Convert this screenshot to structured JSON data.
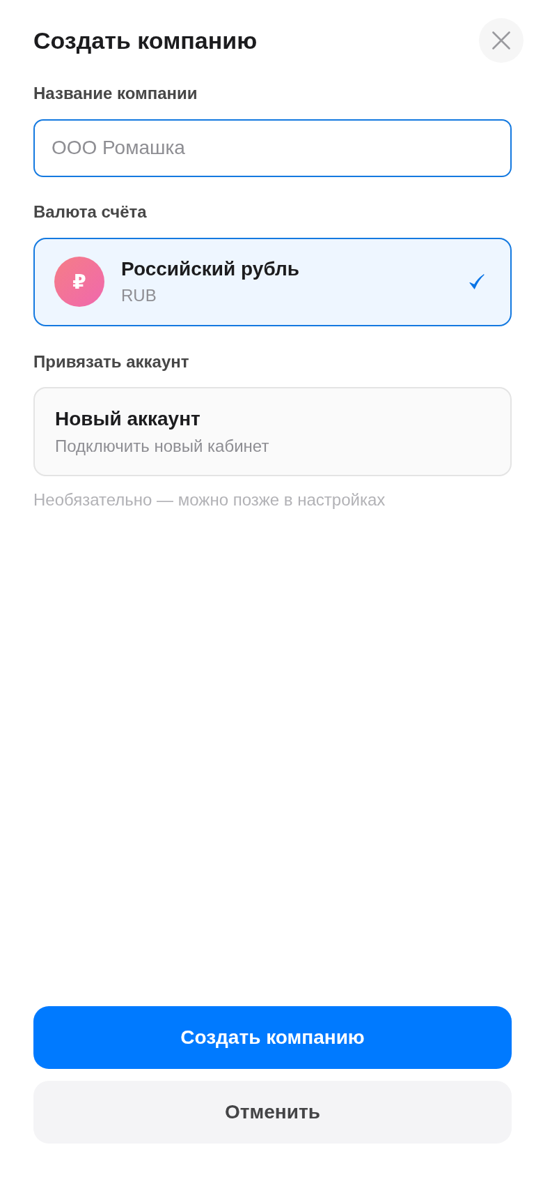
{
  "dialog": {
    "title": "Создать компанию"
  },
  "company_name": {
    "label": "Название компании",
    "placeholder": "ООО Ромашка",
    "focused": true
  },
  "currency": {
    "label": "Валюта счёта",
    "options": [
      {
        "symbol": "₽",
        "name": "Российский рубль",
        "code": "RUB",
        "selected": true
      }
    ]
  },
  "account": {
    "label": "Привязать аккаунт",
    "options": [
      {
        "title": "Новый аккаунт",
        "subtitle": "Подключить новый кабинет",
        "selected": false
      }
    ],
    "hint": "Необязательно — можно позже в настройках"
  },
  "buttons": [
    {
      "kind": "primary",
      "label": "Создать компанию"
    },
    {
      "kind": "secondary",
      "label": "Отменить"
    }
  ]
}
